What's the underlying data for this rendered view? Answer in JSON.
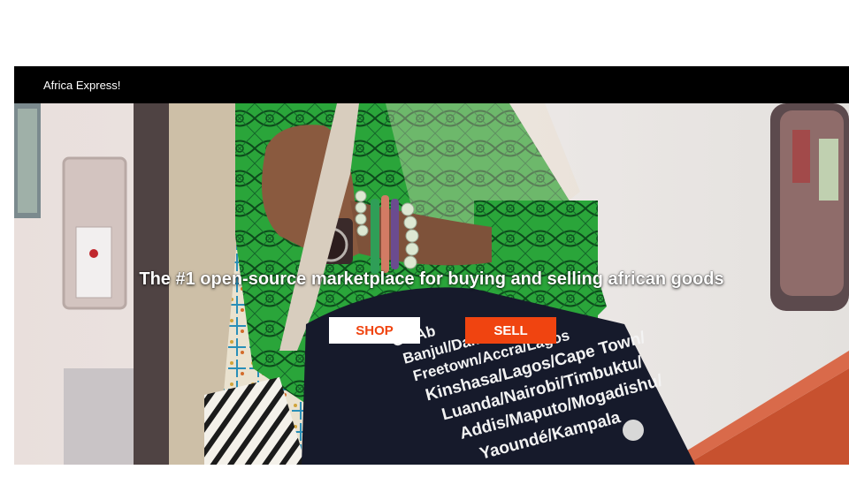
{
  "navbar": {
    "brand": "Africa Express!"
  },
  "hero": {
    "tagline": "The #1 open-source marketplace for buying and selling african goods",
    "shop_label": "SHOP",
    "sell_label": "SELL",
    "bag_print": [
      "Ga/Ab",
      "Banjul/Dakar",
      "Freetown/Accra/Lagos",
      "Kinshasa/Lagos/Cape Town/",
      "Luanda/Nairobi/Timbuktu/",
      "Addis/Maputo/Mogadishu/",
      "Yaoundé/Kampala"
    ]
  },
  "colors": {
    "navbar_bg": "#000000",
    "accent": "#f04410",
    "shop_bg": "#ffffff"
  },
  "icons": {
    "hero_image": "woman-with-tote-bag-photo"
  }
}
